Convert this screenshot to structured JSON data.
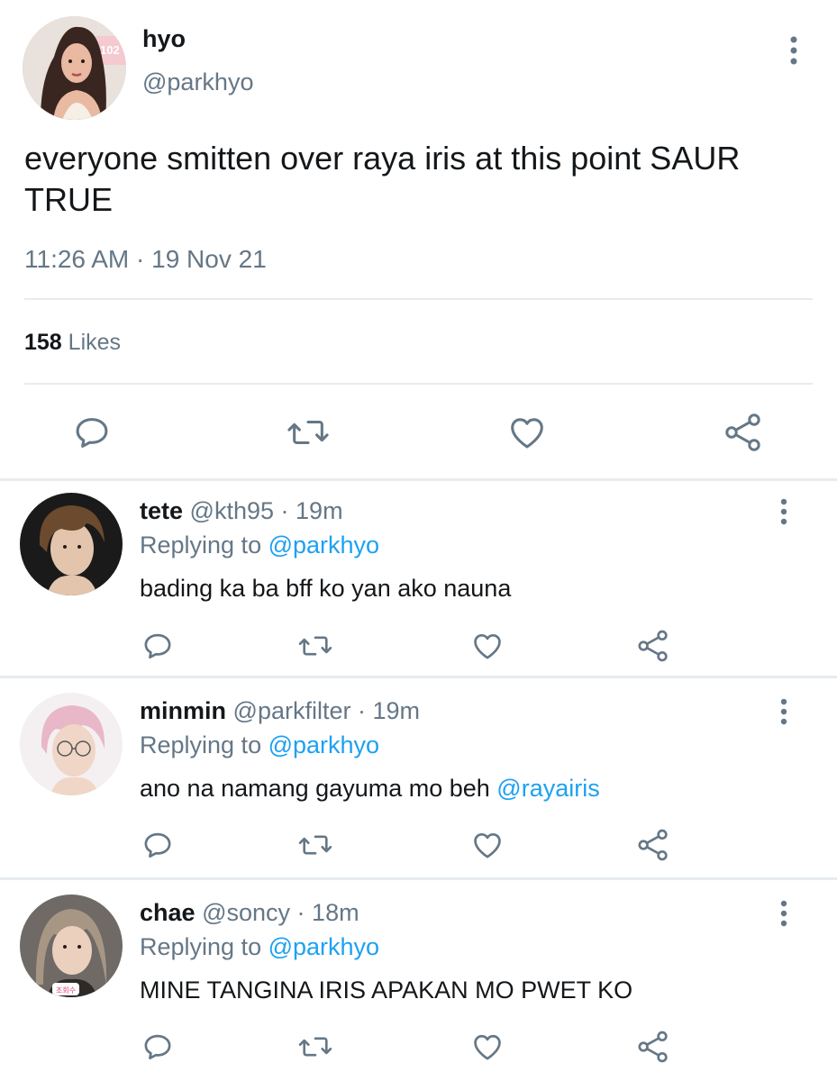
{
  "main_tweet": {
    "display_name": "hyo",
    "handle": "@parkhyo",
    "text": "everyone smitten over raya iris at this point SAUR TRUE",
    "time": "11:26 AM",
    "separator": "·",
    "date": "19 Nov 21",
    "likes_count": "158",
    "likes_label": "Likes",
    "avatar_text": "102"
  },
  "replies": [
    {
      "display_name": "tete",
      "handle": "@kth95",
      "separator": "·",
      "time": "19m",
      "replying_prefix": "Replying to",
      "replying_to": "@parkhyo",
      "text": "bading ka ba bff ko yan ako nauna",
      "mention": ""
    },
    {
      "display_name": "minmin",
      "handle": "@parkfilter",
      "separator": "·",
      "time": "19m",
      "replying_prefix": "Replying to",
      "replying_to": "@parkhyo",
      "text": "ano na namang gayuma mo beh",
      "mention": "@rayairis"
    },
    {
      "display_name": "chae",
      "handle": "@soncy",
      "separator": "·",
      "time": "18m",
      "replying_prefix": "Replying to",
      "replying_to": "@parkhyo",
      "text": "MINE TANGINA IRIS APAKAN MO PWET KO",
      "mention": "",
      "avatar_badge": "조회수"
    }
  ],
  "icons": {
    "reply": "speech-bubble-icon",
    "retweet": "retweet-icon",
    "like": "heart-icon",
    "share": "share-icon",
    "more": "more-vertical-icon"
  },
  "colors": {
    "text": "#14171a",
    "secondary": "#657786",
    "link": "#1da1f2",
    "divider": "#e6ecf0"
  }
}
